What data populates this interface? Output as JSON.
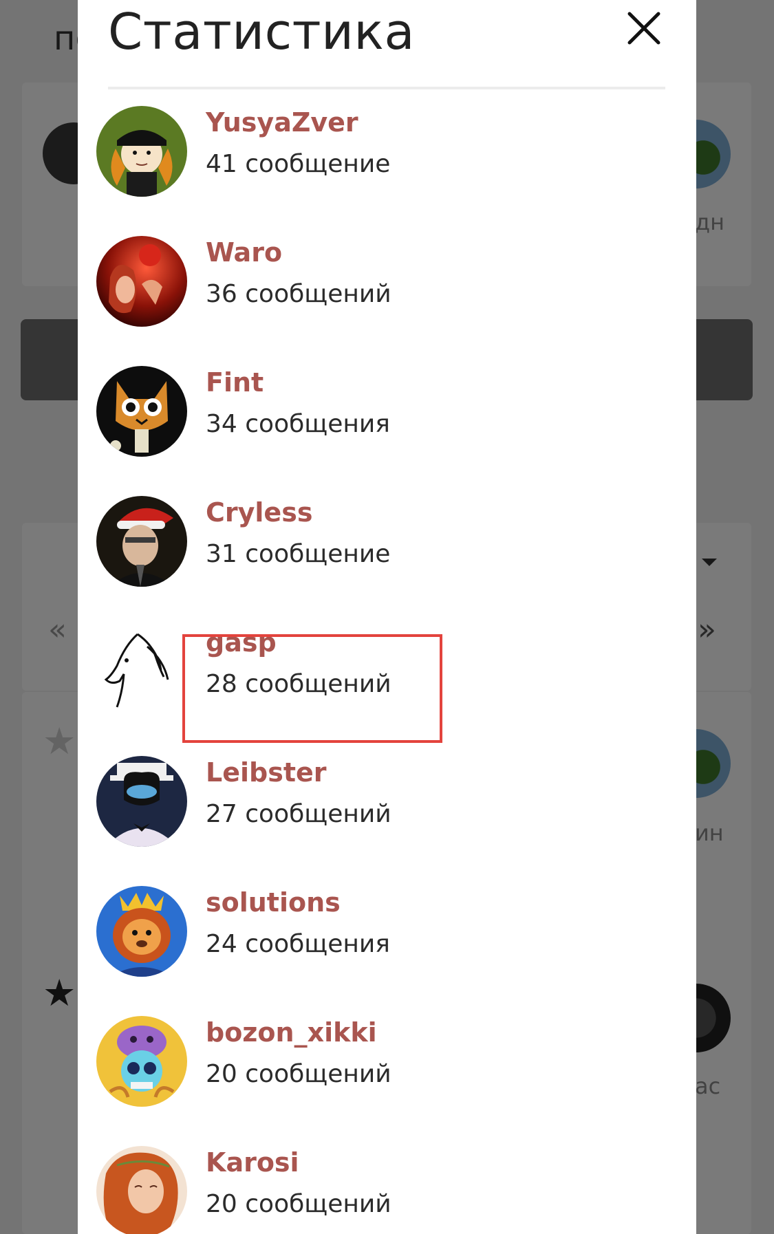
{
  "background": {
    "heading_fragment": "пс",
    "right_text_1": "дн",
    "right_text_2": "ин",
    "right_text_3": "ас",
    "chev_left": "«",
    "chev_right": "»",
    "star": "★"
  },
  "modal": {
    "title": "Статистика",
    "close_icon": "close-icon",
    "users": [
      {
        "name": "YusyaZver",
        "count": "41 сообщение",
        "avatar_icon": "cartoon-avatar-icon"
      },
      {
        "name": "Waro",
        "count": "36 сообщений",
        "avatar_icon": "red-portrait-avatar-icon"
      },
      {
        "name": "Fint",
        "count": "34 сообщения",
        "avatar_icon": "cat-avatar-icon"
      },
      {
        "name": "Cryless",
        "count": "31 сообщение",
        "avatar_icon": "santa-hat-avatar-icon"
      },
      {
        "name": "gasp",
        "count": "28 сообщений",
        "avatar_icon": "horse-sketch-avatar-icon"
      },
      {
        "name": "Leibster",
        "count": "27 сообщений",
        "avatar_icon": "masked-man-avatar-icon"
      },
      {
        "name": "solutions",
        "count": "24 сообщения",
        "avatar_icon": "lion-king-avatar-icon"
      },
      {
        "name": "bozon_xikki",
        "count": "20 сообщений",
        "avatar_icon": "skull-octopus-avatar-icon"
      },
      {
        "name": "Karosi",
        "count": "20 сообщений",
        "avatar_icon": "redhead-art-avatar-icon"
      }
    ]
  },
  "colors": {
    "username": "#a9554f",
    "highlight": "#e3433d",
    "overlay": "rgba(0,0,0,0.52)"
  }
}
